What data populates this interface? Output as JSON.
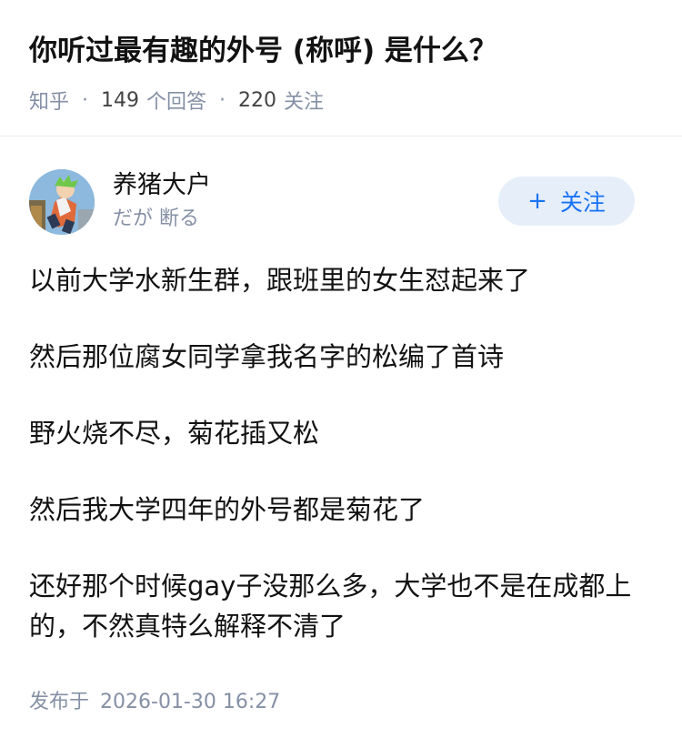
{
  "question": {
    "title": "你听过最有趣的外号 (称呼) 是什么？",
    "source": "知乎",
    "answer_count": "149",
    "answer_label": "个回答",
    "follower_count": "220",
    "follower_label": "关注",
    "separator": "·"
  },
  "author": {
    "name": "养猪大户",
    "bio": "だが 断る",
    "follow_icon": "+",
    "follow_label": "关注"
  },
  "answer": {
    "paragraphs": [
      "以前大学水新生群，跟班里的女生怼起来了",
      "然后那位腐女同学拿我名字的松编了首诗",
      "野火烧不尽，菊花插又松",
      "然后我大学四年的外号都是菊花了",
      "还好那个时候gay子没那么多，大学也不是在成都上的，不然真特么解释不清了"
    ],
    "time_label": "发布于",
    "time": "2026-01-30 16:27"
  },
  "colors": {
    "accent": "#1772f6",
    "follow_bg": "#e5eef9",
    "meta": "#8590a6",
    "text": "#121212"
  }
}
